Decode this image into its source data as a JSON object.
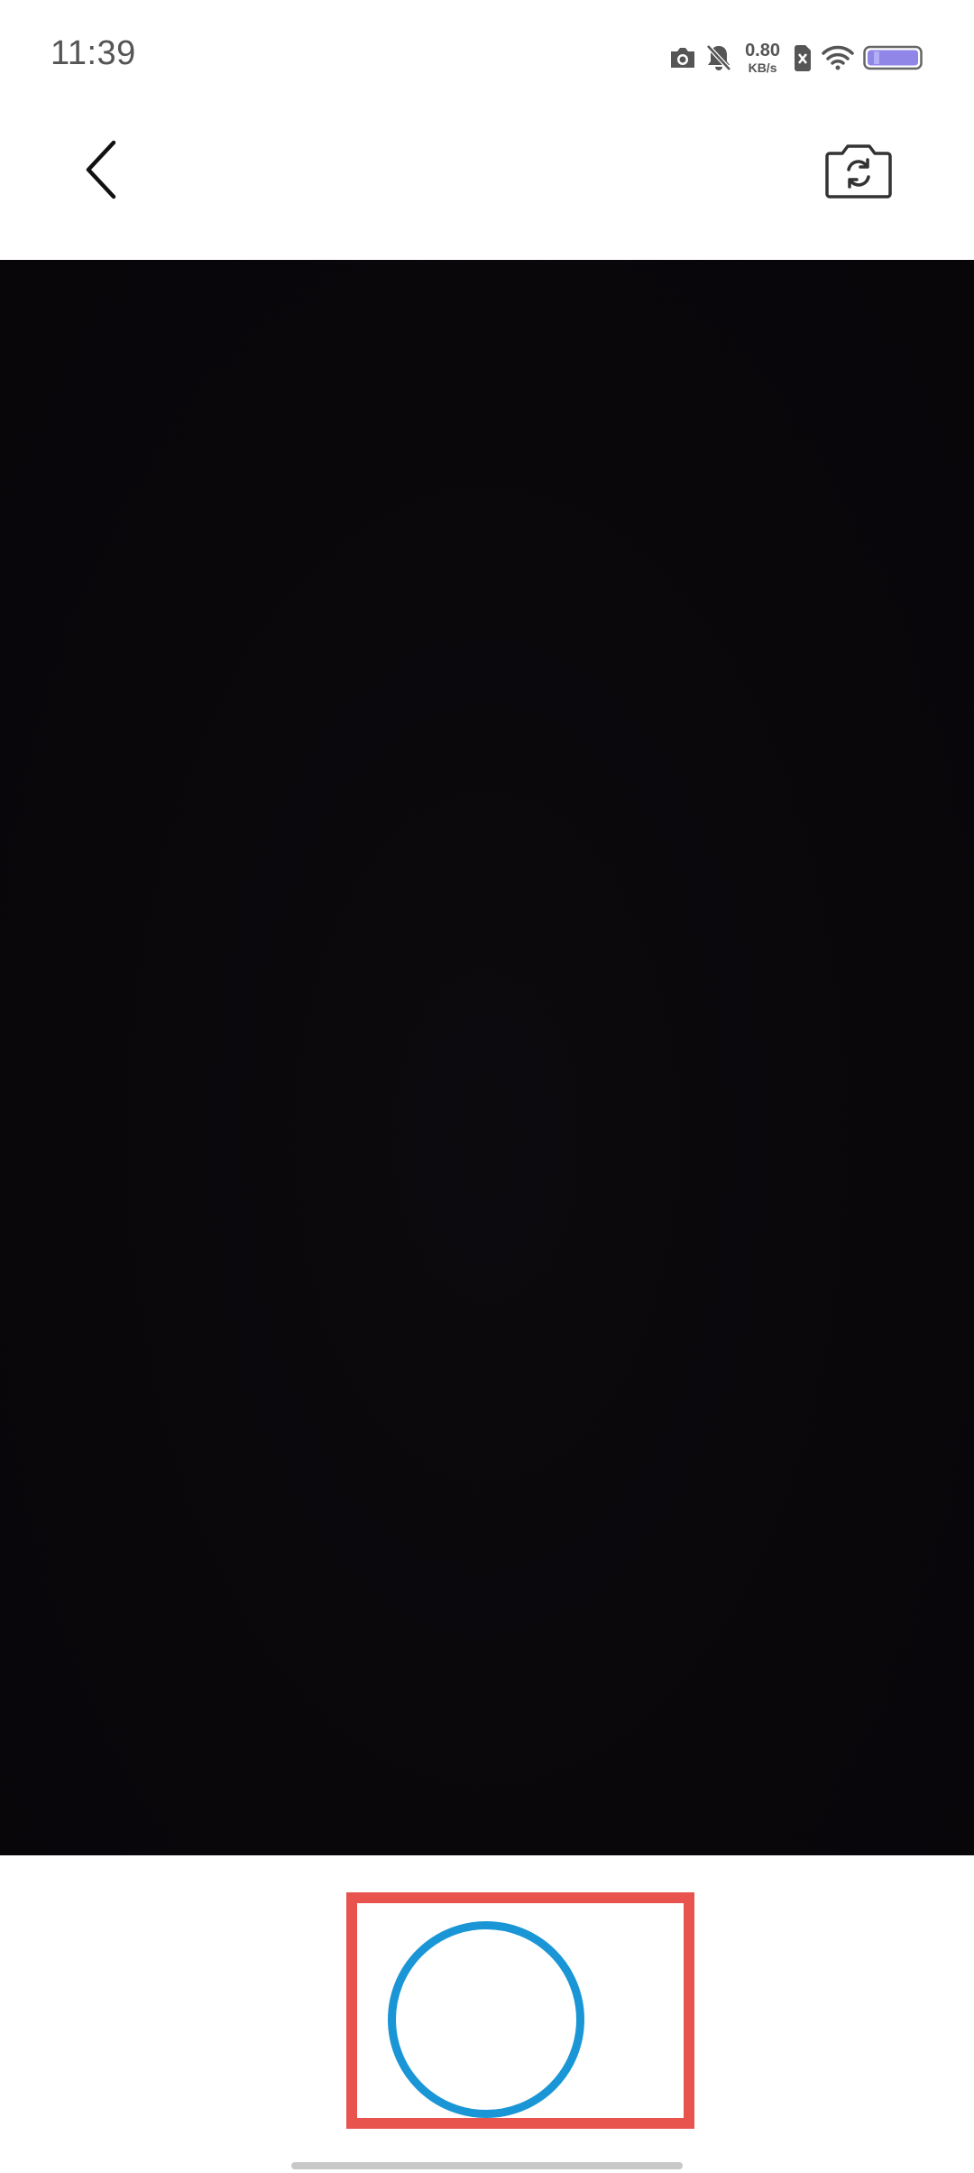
{
  "status_bar": {
    "time": "11:39",
    "net_speed_value": "0.80",
    "net_speed_unit": "KB/s",
    "icons": [
      "camera-icon",
      "mute-icon",
      "sim-off-icon",
      "wifi-icon",
      "battery-icon"
    ],
    "battery_color": "#8f86e8"
  },
  "header": {
    "back_icon": "chevron-left-icon",
    "switch_icon": "camera-switch-icon"
  },
  "colors": {
    "preview_bg": "#09070a",
    "shutter_ring": "#1a96d6",
    "highlight_box": "#e8534e"
  }
}
